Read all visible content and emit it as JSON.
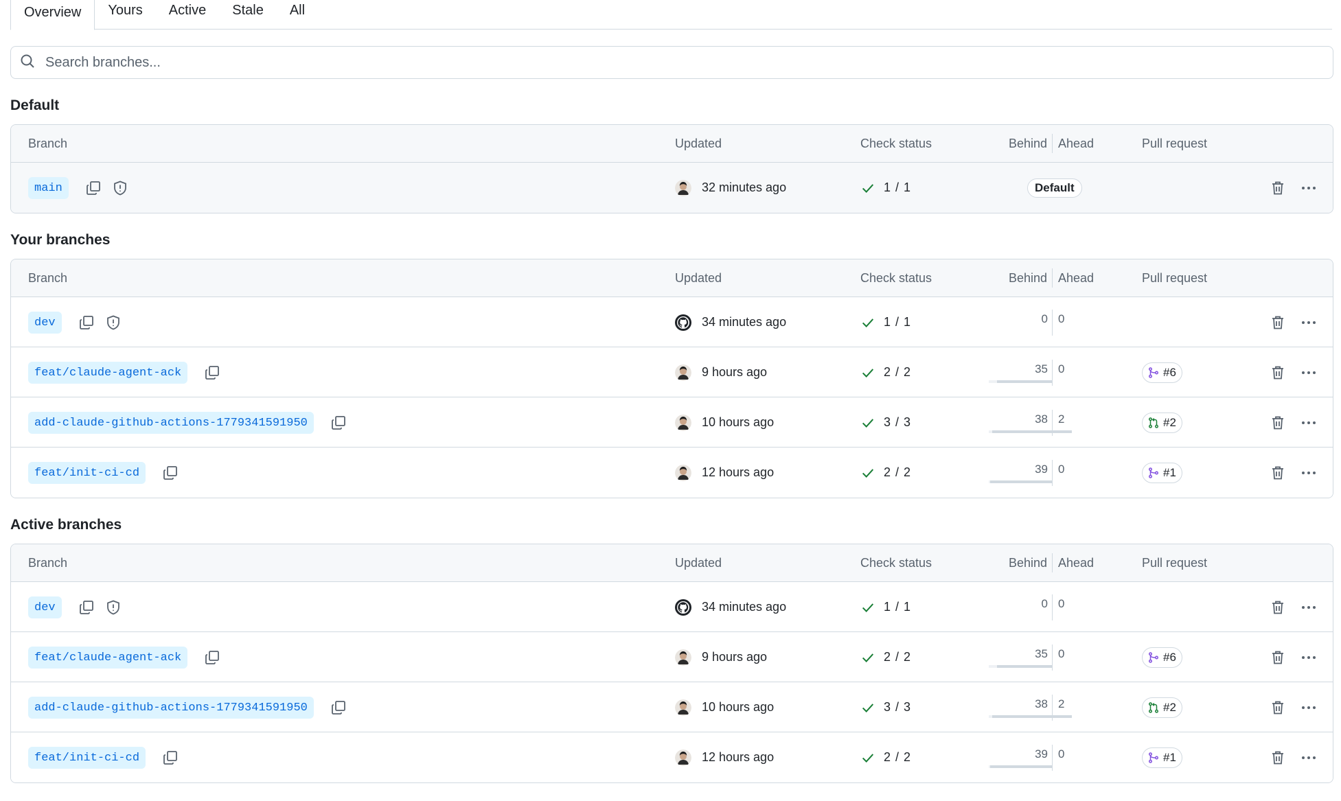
{
  "tabs": [
    {
      "label": "Overview",
      "selected": true
    },
    {
      "label": "Yours",
      "selected": false
    },
    {
      "label": "Active",
      "selected": false
    },
    {
      "label": "Stale",
      "selected": false
    },
    {
      "label": "All",
      "selected": false
    }
  ],
  "search": {
    "placeholder": "Search branches..."
  },
  "columns": {
    "branch": "Branch",
    "updated": "Updated",
    "check_status": "Check status",
    "behind": "Behind",
    "ahead": "Ahead",
    "pull_request": "Pull request"
  },
  "sections": {
    "default": {
      "title": "Default",
      "rows": [
        {
          "name": "main",
          "updated": "32 minutes ago",
          "checks": "1 / 1",
          "badge": "Default",
          "avatar": "user"
        }
      ]
    },
    "yours": {
      "title": "Your branches",
      "rows": [
        {
          "name": "dev",
          "updated": "34 minutes ago",
          "checks": "1 / 1",
          "behind": "0",
          "ahead": "0",
          "avatar": "github",
          "protected": true
        },
        {
          "name": "feat/claude-agent-ack",
          "updated": "9 hours ago",
          "checks": "2 / 2",
          "behind": "35",
          "ahead": "0",
          "pr": "#6",
          "pr_state": "merged",
          "avatar": "user"
        },
        {
          "name": "add-claude-github-actions-1779341591950",
          "updated": "10 hours ago",
          "checks": "3 / 3",
          "behind": "38",
          "ahead": "2",
          "pr": "#2",
          "pr_state": "open",
          "avatar": "user"
        },
        {
          "name": "feat/init-ci-cd",
          "updated": "12 hours ago",
          "checks": "2 / 2",
          "behind": "39",
          "ahead": "0",
          "pr": "#1",
          "pr_state": "merged",
          "avatar": "user"
        }
      ]
    },
    "active": {
      "title": "Active branches",
      "rows": [
        {
          "name": "dev",
          "updated": "34 minutes ago",
          "checks": "1 / 1",
          "behind": "0",
          "ahead": "0",
          "avatar": "github",
          "protected": true
        },
        {
          "name": "feat/claude-agent-ack",
          "updated": "9 hours ago",
          "checks": "2 / 2",
          "behind": "35",
          "ahead": "0",
          "pr": "#6",
          "pr_state": "merged",
          "avatar": "user"
        },
        {
          "name": "add-claude-github-actions-1779341591950",
          "updated": "10 hours ago",
          "checks": "3 / 3",
          "behind": "38",
          "ahead": "2",
          "pr": "#2",
          "pr_state": "open",
          "avatar": "user"
        },
        {
          "name": "feat/init-ci-cd",
          "updated": "12 hours ago",
          "checks": "2 / 2",
          "behind": "39",
          "ahead": "0",
          "pr": "#1",
          "pr_state": "merged",
          "avatar": "user"
        }
      ]
    }
  },
  "colors": {
    "branch_chip_bg": "#ddf4ff",
    "branch_chip_text": "#0969da",
    "check_success": "#1a7f37",
    "pr_merged": "#8250df",
    "pr_open": "#1a7f37",
    "border": "#d1d9e0"
  },
  "icons": {
    "search": "search-icon",
    "copy": "copy-icon",
    "shield": "shield-icon",
    "check": "check-icon",
    "merged": "git-merge-icon",
    "open": "git-pull-request-icon",
    "trash": "trash-icon",
    "more": "kebab-horizontal-icon"
  }
}
